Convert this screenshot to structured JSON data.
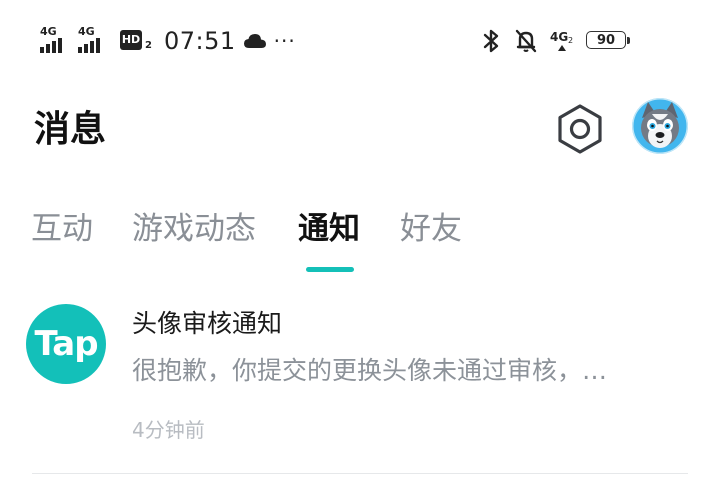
{
  "status_bar": {
    "signal1_label": "4G",
    "signal2_label": "4G",
    "hd_label": "HD",
    "hd_sub": "2",
    "time": "07:51",
    "more": "···",
    "network_label": "4G",
    "network_sub": "2",
    "battery": "90",
    "icons": [
      "signal-icon",
      "hd-voice-icon",
      "cloud-icon",
      "bluetooth-icon",
      "mute-bell-icon",
      "battery-icon"
    ]
  },
  "header": {
    "title": "消息",
    "settings_icon": "hexagon-gear-icon",
    "avatar_icon": "husky-avatar"
  },
  "tabs": {
    "items": [
      {
        "label": "互动"
      },
      {
        "label": "游戏动态"
      },
      {
        "label": "通知"
      },
      {
        "label": "好友"
      }
    ],
    "active_index": 2,
    "accent_color": "#14c0b8"
  },
  "notifications": [
    {
      "logo_text": "Tap",
      "logo_color": "#13c0b9",
      "title": "头像审核通知",
      "body": "很抱歉，你提交的更换头像未通过审核，…",
      "time": "4分钟前"
    }
  ]
}
